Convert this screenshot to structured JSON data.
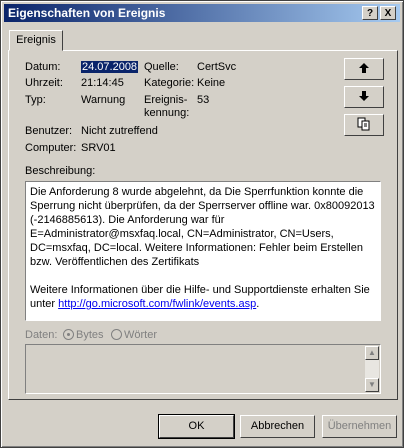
{
  "window": {
    "title": "Eigenschaften von Ereignis",
    "help_label": "?",
    "close_label": "X"
  },
  "tabs": [
    {
      "label": "Ereignis"
    }
  ],
  "event": {
    "date_label": "Datum:",
    "date_value": "24.07.2008",
    "time_label": "Uhrzeit:",
    "time_value": "21:14:45",
    "type_label": "Typ:",
    "type_value": "Warnung",
    "user_label": "Benutzer:",
    "user_value": "Nicht zutreffend",
    "computer_label": "Computer:",
    "computer_value": "SRV01",
    "source_label": "Quelle:",
    "source_value": "CertSvc",
    "category_label": "Kategorie:",
    "category_value": "Keine",
    "eventid_label_line1": "Ereignis-",
    "eventid_label_line2": "kennung:",
    "eventid_value": "53"
  },
  "nav": {
    "up_icon": "arrow-up-icon",
    "down_icon": "arrow-down-icon",
    "copy_icon": "copy-icon"
  },
  "description": {
    "label": "Beschreibung:",
    "paragraph1": "Die Anforderung 8 wurde abgelehnt, da Die Sperrfunktion konnte die Sperrung nicht überprüfen, da der Sperrserver offline war. 0x80092013 (-2146885613). Die Anforderung war für E=Administrator@msxfaq.local, CN=Administrator, CN=Users, DC=msxfaq, DC=local. Weitere Informationen: Fehler beim Erstellen bzw. Veröffentlichen des Zertifikats",
    "paragraph2": "Weitere Informationen über die Hilfe- und Supportdienste erhalten Sie unter ",
    "link": "http://go.microsoft.com/fwlink/events.asp",
    "after_link": "."
  },
  "data_section": {
    "label": "Daten:",
    "bytes_label": "Bytes",
    "words_label": "Wörter",
    "selected": "Bytes"
  },
  "buttons": {
    "ok": "OK",
    "cancel": "Abbrechen",
    "apply": "Übernehmen"
  }
}
